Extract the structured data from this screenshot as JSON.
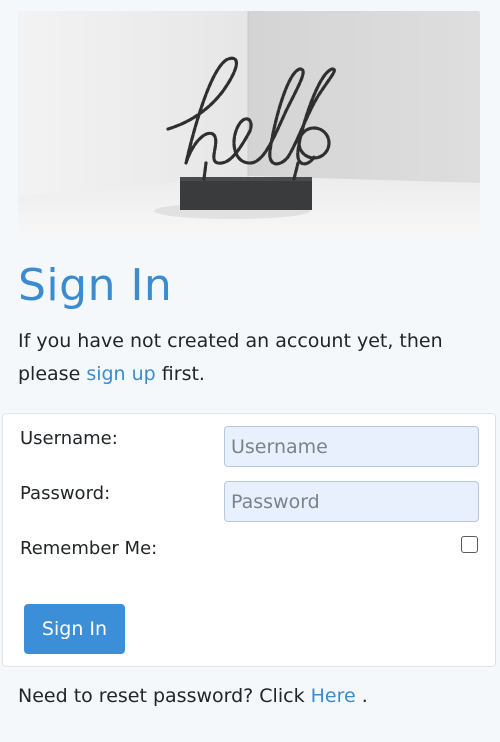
{
  "hero": {
    "sign_text": "hello"
  },
  "header": {
    "title": "Sign In"
  },
  "intro": {
    "text_before": "If you have not created an account yet, then please ",
    "link_text": "sign up",
    "text_after": " first."
  },
  "form": {
    "username_label": "Username:",
    "username_placeholder": "Username",
    "username_value": "",
    "password_label": "Password:",
    "password_placeholder": "Password",
    "password_value": "",
    "remember_label": "Remember Me:",
    "remember_checked": false,
    "submit_label": "Sign In"
  },
  "footer": {
    "text_before": "Need to reset password? Click ",
    "link_text": "Here",
    "text_after": " ."
  },
  "colors": {
    "accent": "#3b8bd0",
    "button": "#3b8fd9",
    "input_bg": "#e8f0fe",
    "page_bg": "#f5f8fa"
  }
}
